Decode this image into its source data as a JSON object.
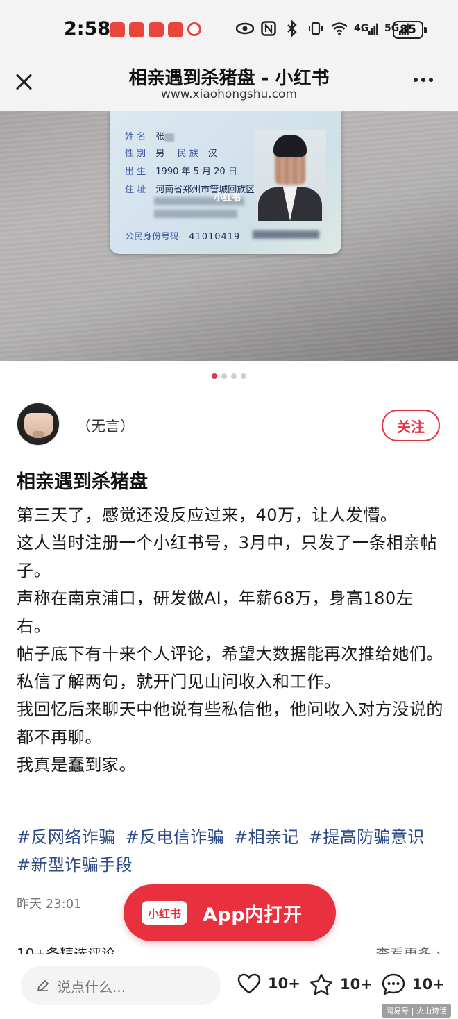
{
  "status_bar": {
    "time": "2:58",
    "network_1": "4G",
    "network_2": "5G",
    "battery": "85"
  },
  "header": {
    "title": "相亲遇到杀猪盘 - 小红书",
    "url": "www.xiaohongshu.com"
  },
  "photo": {
    "card": {
      "name_label": "姓 名",
      "name_value": "张",
      "sex_label": "性 别",
      "sex_value": "男",
      "ethnicity_label": "民 族",
      "ethnicity_value": "汉",
      "birth_label": "出 生",
      "birth_value": "1990 年 5 月 20 日",
      "address_label": "住 址",
      "address_value": "河南省郑州市管城回族区",
      "id_label": "公民身份号码",
      "id_value": "41010419",
      "watermark": "小红书"
    },
    "carousel_count": 4,
    "carousel_active": 1
  },
  "author": {
    "name": "（无言）",
    "follow_label": "关注"
  },
  "post": {
    "title": "相亲遇到杀猪盘",
    "paragraphs": [
      "第三天了，感觉还没反应过来，40万，让人发懵。",
      "这人当时注册一个小红书号，3月中，只发了一条相亲帖子。",
      "声称在南京浦口，研发做AI，年薪68万，身高180左右。",
      "帖子底下有十来个人评论，希望大数据能再次推给她们。",
      "私信了解两句，就开门见山问收入和工作。",
      "我回忆后来聊天中他说有些私信他，他问收入对方没说的都不再聊。",
      "我真是蠢到家。"
    ],
    "tags": [
      "#反网络诈骗",
      "#反电信诈骗",
      "#相亲记",
      "#提高防骗意识",
      "#新型诈骗手段"
    ],
    "date": "昨天 23:01"
  },
  "open_app": {
    "logo": "小红书",
    "label": "App内打开"
  },
  "comments": {
    "left": "10+条精选评论",
    "right": "查看更多 ›"
  },
  "bottom_bar": {
    "input_placeholder": "说点什么...",
    "like_count": "10+",
    "collect_count": "10+",
    "comment_count": "10+",
    "credit": "网易号 | 火山诗话"
  },
  "colors": {
    "accent": "#e8303f",
    "tag": "#2d4a8a"
  }
}
